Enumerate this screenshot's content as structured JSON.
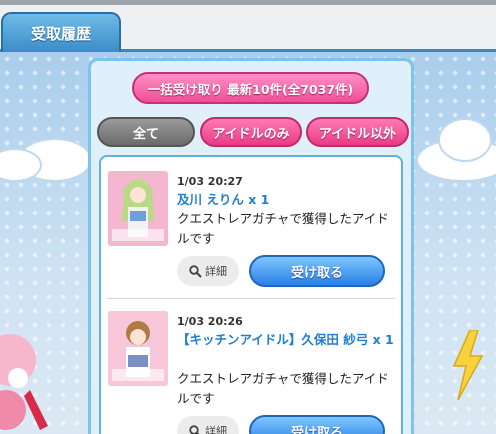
{
  "header": {
    "tabs": [
      {
        "label": "受取履歴",
        "active": true
      }
    ]
  },
  "panel": {
    "bulk_receive_label": "一括受け取り 最新10件(全7037件)",
    "filters": [
      {
        "label": "全て",
        "active": true
      },
      {
        "label": "アイドルのみ",
        "active": false
      },
      {
        "label": "アイドル以外",
        "active": false
      }
    ],
    "items": [
      {
        "time": "1/03 20:27",
        "name": "及川 えりん x 1",
        "desc": "クエストレアガチャで獲得したアイドルです",
        "detail_label": "詳細",
        "receive_label": "受け取る"
      },
      {
        "time": "1/03 20:26",
        "name": "【キッチンアイドル】久保田 紗弓 x 1",
        "desc": "クエストレアガチャで獲得したアイドルです",
        "detail_label": "詳細",
        "receive_label": "受け取る"
      }
    ]
  },
  "colors": {
    "accent_blue": "#3b8cc8",
    "pink": "#ef4f98",
    "link_blue": "#1f7fd3"
  }
}
